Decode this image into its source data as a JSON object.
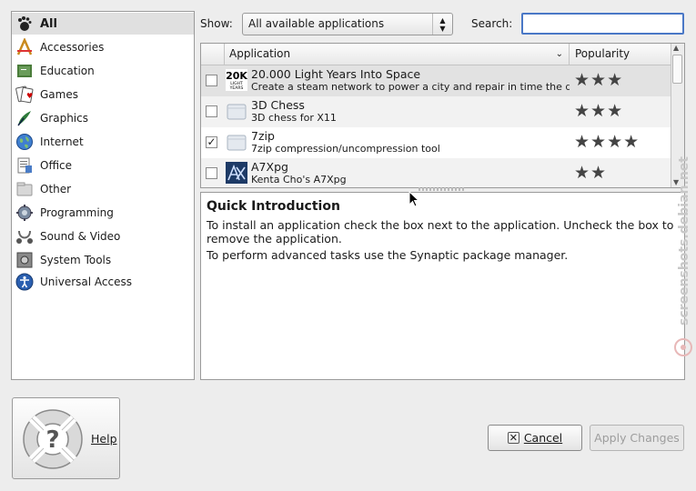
{
  "sidebar": {
    "categories": [
      {
        "label": "All",
        "icon": "gnome-foot-icon",
        "selected": true
      },
      {
        "label": "Accessories",
        "icon": "accessories-icon"
      },
      {
        "label": "Education",
        "icon": "education-icon"
      },
      {
        "label": "Games",
        "icon": "games-icon"
      },
      {
        "label": "Graphics",
        "icon": "graphics-icon"
      },
      {
        "label": "Internet",
        "icon": "internet-icon"
      },
      {
        "label": "Office",
        "icon": "office-icon"
      },
      {
        "label": "Other",
        "icon": "other-icon"
      },
      {
        "label": "Programming",
        "icon": "programming-icon"
      },
      {
        "label": "Sound & Video",
        "icon": "sound-video-icon"
      },
      {
        "label": "System Tools",
        "icon": "system-tools-icon"
      },
      {
        "label": "Universal Access",
        "icon": "universal-access-icon"
      }
    ]
  },
  "toolbar": {
    "show_label": "Show:",
    "show_value": "All available applications",
    "search_label": "Search:",
    "search_value": ""
  },
  "app_list": {
    "columns": {
      "application": "Application",
      "popularity": "Popularity"
    },
    "rows": [
      {
        "name": "20.000 Light Years Into Space",
        "description": "Create a steam network to power a city and repair in time the dama…",
        "checked": false,
        "popularity": 3,
        "icon": "lightyears-icon",
        "icon_text": "20K",
        "icon_subtext": "LIGHT YEARS"
      },
      {
        "name": "3D Chess",
        "description": "3D chess for X11",
        "checked": false,
        "popularity": 3,
        "icon": "package-icon"
      },
      {
        "name": "7zip",
        "description": "7zip compression/uncompression tool",
        "checked": true,
        "popularity": 4,
        "icon": "package-icon"
      },
      {
        "name": "A7Xpg",
        "description": "Kenta Cho's A7Xpg",
        "checked": false,
        "popularity": 2,
        "icon": "a7xpg-icon"
      }
    ]
  },
  "description": {
    "title": "Quick Introduction",
    "paragraphs": [
      "To install an application check the box next to the application. Uncheck the box to remove the application.",
      "To perform advanced tasks use the Synaptic package manager."
    ]
  },
  "buttons": {
    "help_label": "Help",
    "cancel_label": "Cancel",
    "apply_label": "Apply Changes"
  },
  "watermark": "screenshots.debian.net",
  "colors": {
    "focus_border": "#4a78c6",
    "selected_row": "#e2e2e2"
  }
}
